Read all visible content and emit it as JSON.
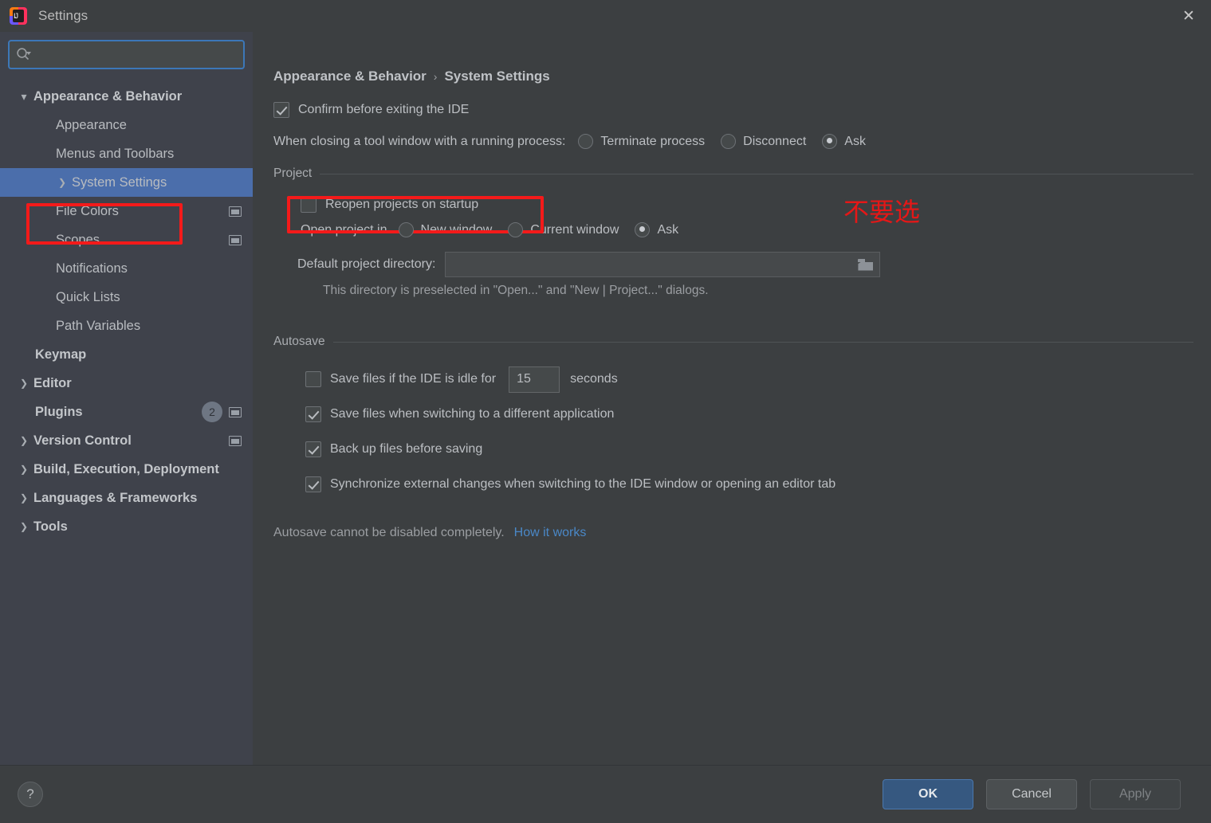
{
  "window": {
    "title": "Settings",
    "app_icon": "intellij-idea-icon",
    "close_icon": "✕",
    "ij_letters": "IJ"
  },
  "sidebar": {
    "search": {
      "placeholder": "",
      "value": "",
      "icon": "search-icon"
    },
    "items": [
      {
        "label": "Appearance & Behavior",
        "level": 0,
        "arrow": "down",
        "bold": true,
        "selected": false,
        "badge": null,
        "window_icon": false
      },
      {
        "label": "Appearance",
        "level": 1,
        "arrow": "none",
        "bold": false,
        "selected": false,
        "badge": null,
        "window_icon": false
      },
      {
        "label": "Menus and Toolbars",
        "level": 1,
        "arrow": "none",
        "bold": false,
        "selected": false,
        "badge": null,
        "window_icon": false
      },
      {
        "label": "System Settings",
        "level": 1,
        "arrow": "right",
        "bold": false,
        "selected": true,
        "badge": null,
        "window_icon": false
      },
      {
        "label": "File Colors",
        "level": 1,
        "arrow": "none",
        "bold": false,
        "selected": false,
        "badge": null,
        "window_icon": true
      },
      {
        "label": "Scopes",
        "level": 1,
        "arrow": "none",
        "bold": false,
        "selected": false,
        "badge": null,
        "window_icon": true
      },
      {
        "label": "Notifications",
        "level": 1,
        "arrow": "none",
        "bold": false,
        "selected": false,
        "badge": null,
        "window_icon": false
      },
      {
        "label": "Quick Lists",
        "level": 1,
        "arrow": "none",
        "bold": false,
        "selected": false,
        "badge": null,
        "window_icon": false
      },
      {
        "label": "Path Variables",
        "level": 1,
        "arrow": "none",
        "bold": false,
        "selected": false,
        "badge": null,
        "window_icon": false
      },
      {
        "label": "Keymap",
        "level": 0,
        "arrow": "none",
        "bold": true,
        "selected": false,
        "badge": null,
        "window_icon": false
      },
      {
        "label": "Editor",
        "level": 0,
        "arrow": "right",
        "bold": true,
        "selected": false,
        "badge": null,
        "window_icon": false
      },
      {
        "label": "Plugins",
        "level": 0,
        "arrow": "none",
        "bold": true,
        "selected": false,
        "badge": "2",
        "window_icon": true
      },
      {
        "label": "Version Control",
        "level": 0,
        "arrow": "right",
        "bold": true,
        "selected": false,
        "badge": null,
        "window_icon": true
      },
      {
        "label": "Build, Execution, Deployment",
        "level": 0,
        "arrow": "right",
        "bold": true,
        "selected": false,
        "badge": null,
        "window_icon": false
      },
      {
        "label": "Languages & Frameworks",
        "level": 0,
        "arrow": "right",
        "bold": true,
        "selected": false,
        "badge": null,
        "window_icon": false
      },
      {
        "label": "Tools",
        "level": 0,
        "arrow": "right",
        "bold": true,
        "selected": false,
        "badge": null,
        "window_icon": false
      }
    ]
  },
  "breadcrumb": {
    "root": "Appearance & Behavior",
    "separator": "›",
    "current": "System Settings"
  },
  "main": {
    "confirm_exit": {
      "label": "Confirm before exiting the IDE",
      "checked": true
    },
    "closing_tool_window": {
      "label": "When closing a tool window with a running process:",
      "options": [
        {
          "label": "Terminate process",
          "selected": false
        },
        {
          "label": "Disconnect",
          "selected": false
        },
        {
          "label": "Ask",
          "selected": true
        }
      ]
    },
    "project": {
      "group_title": "Project",
      "reopen": {
        "label": "Reopen projects on startup",
        "checked": false
      },
      "open_project_in": {
        "label": "Open project in",
        "options": [
          {
            "label": "New window",
            "selected": false
          },
          {
            "label": "Current window",
            "selected": false
          },
          {
            "label": "Ask",
            "selected": true
          }
        ]
      },
      "default_dir": {
        "label": "Default project directory:",
        "value": "",
        "browse_icon": "folder-icon"
      },
      "hint": "This directory is preselected in \"Open...\" and \"New | Project...\" dialogs."
    },
    "autosave": {
      "group_title": "Autosave",
      "idle": {
        "label": "Save files if the IDE is idle for",
        "checked": false,
        "seconds_value": "15",
        "unit_label": "seconds"
      },
      "options": [
        {
          "label": "Save files when switching to a different application",
          "checked": true
        },
        {
          "label": "Back up files before saving",
          "checked": true
        },
        {
          "label": "Synchronize external changes when switching to the IDE window or opening an editor tab",
          "checked": true
        }
      ],
      "note": "Autosave cannot be disabled completely.",
      "link": "How it works"
    }
  },
  "annotations": {
    "chinese_note": "不要选",
    "box_color": "#f41a1a",
    "note_color": "#e51717"
  },
  "footer": {
    "help_icon": "?",
    "ok": "OK",
    "cancel": "Cancel",
    "apply": "Apply"
  }
}
